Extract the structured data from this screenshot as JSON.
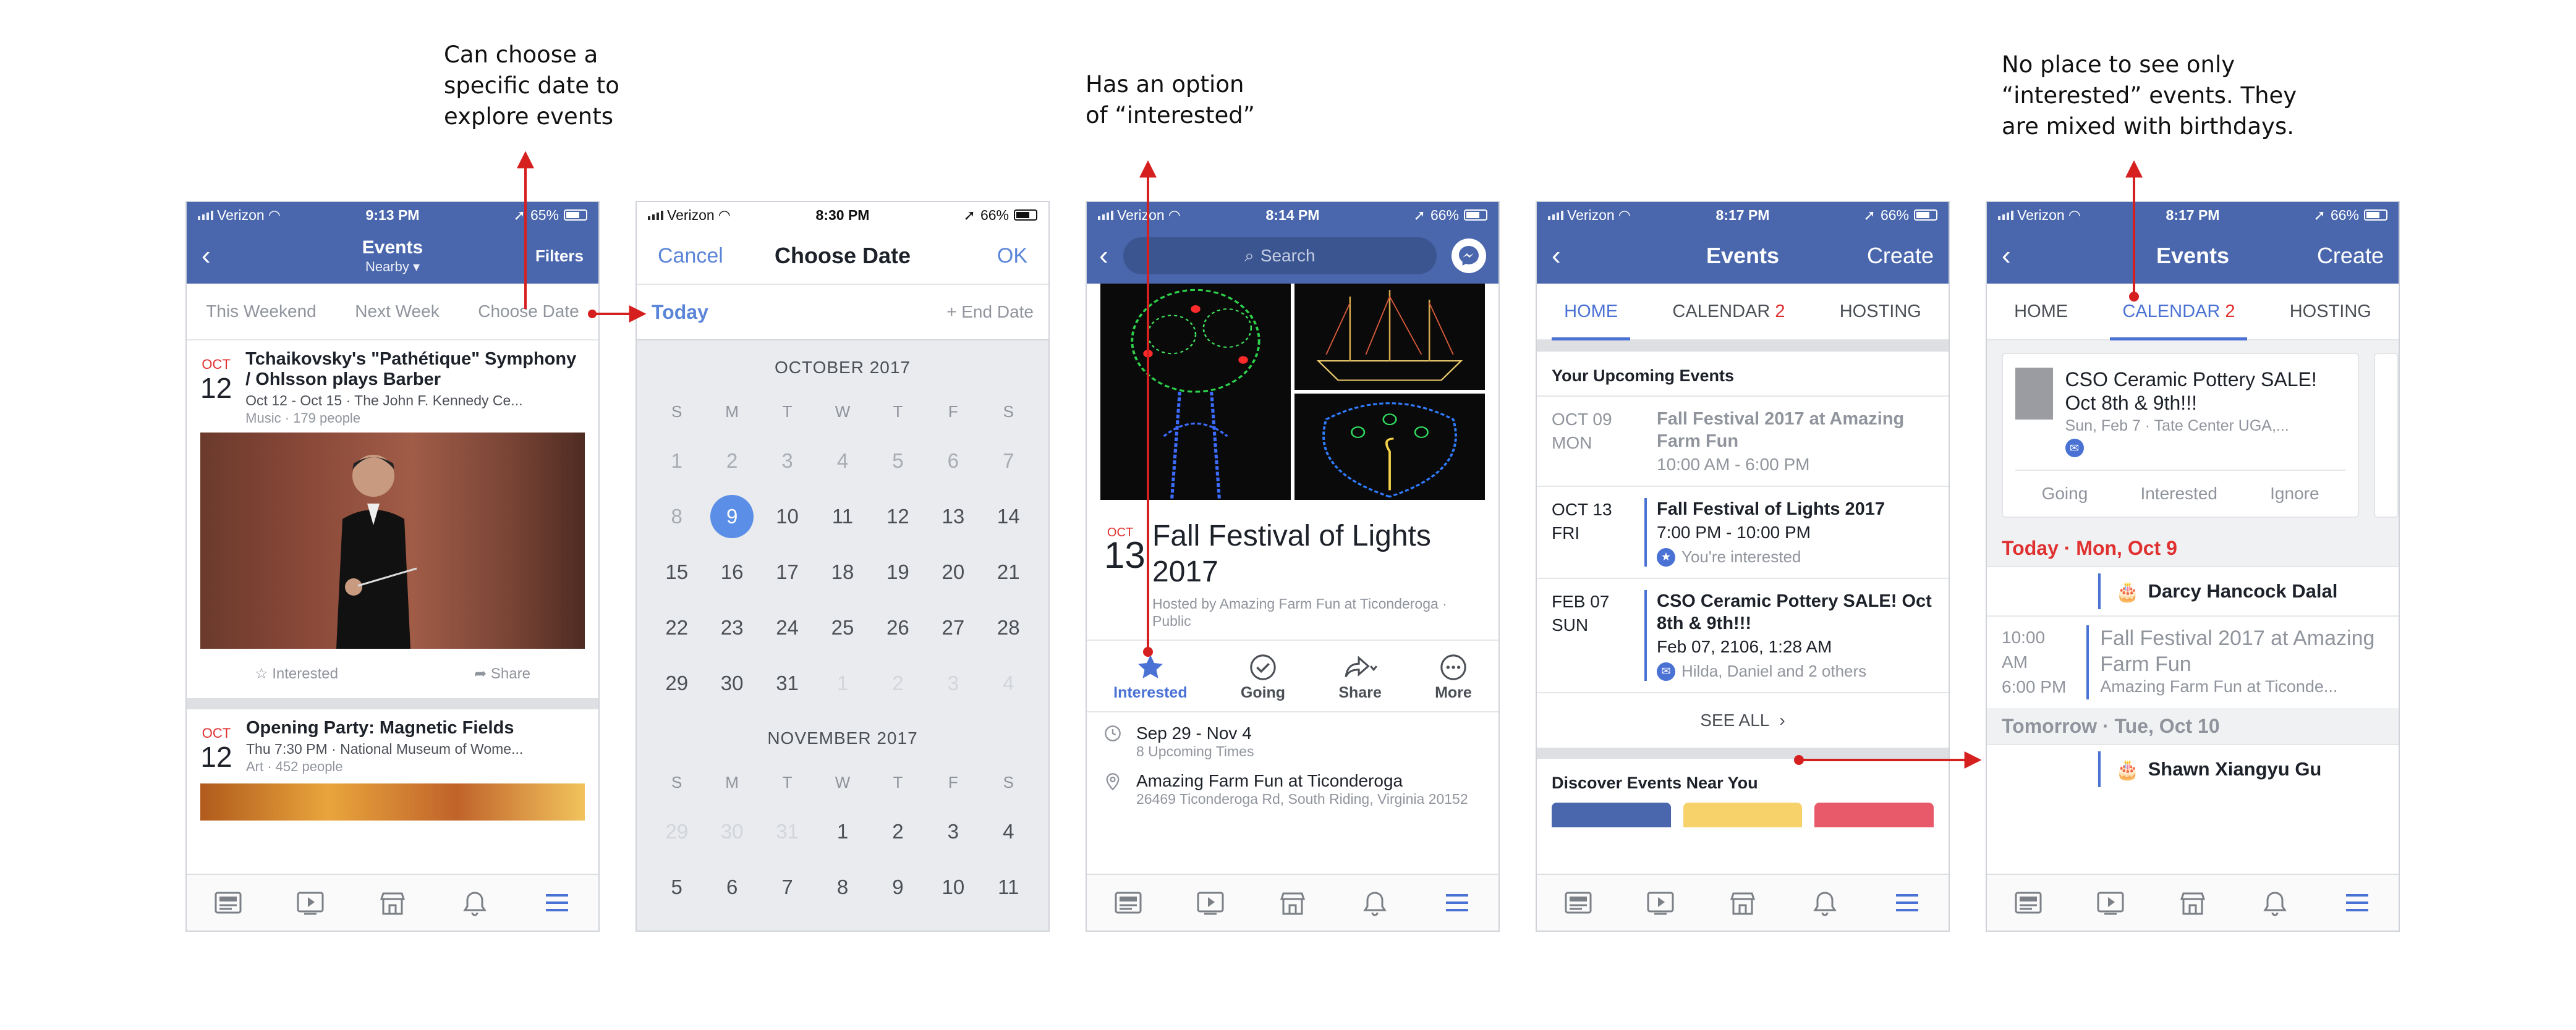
{
  "annotations": {
    "a1": [
      "Can choose a",
      "specific date to",
      "explore events"
    ],
    "a2": [
      "Has an option",
      "of “interested”"
    ],
    "a3": [
      "No place to see only",
      "“interested” events. They",
      "are mixed with birthdays."
    ]
  },
  "colors": {
    "fb_blue": "#4a67ad",
    "link_blue": "#5b85d8",
    "accent_red": "#e03131",
    "annotation_arrow": "#d61f1f"
  },
  "tabbar_icons": [
    "news-feed-icon",
    "video-icon",
    "marketplace-icon",
    "notifications-icon",
    "menu-icon"
  ],
  "phone1": {
    "status": {
      "carrier": "Verizon",
      "time": "9:13 PM",
      "battery": "65%"
    },
    "nav": {
      "title": "Events",
      "subtitle": "Nearby ▾",
      "right": "Filters"
    },
    "filters": [
      "This Weekend",
      "Next Week",
      "Choose Date"
    ],
    "event1": {
      "month": "OCT",
      "day": "12",
      "title": "Tchaikovsky's \"Pathétique\" Symphony / Ohlsson plays Barber",
      "sub": "Oct 12 - Oct 15 · The John F. Kennedy Ce...",
      "meta": "Music · 179 people"
    },
    "actions": {
      "interested": "Interested",
      "share": "Share"
    },
    "event2": {
      "month": "OCT",
      "day": "12",
      "title": "Opening Party: Magnetic Fields",
      "sub": "Thu 7:30 PM · National Museum of Wome...",
      "meta": "Art · 452 people"
    }
  },
  "phone2": {
    "status": {
      "carrier": "Verizon",
      "time": "8:30 PM",
      "battery": "66%"
    },
    "header": {
      "cancel": "Cancel",
      "title": "Choose Date",
      "ok": "OK"
    },
    "range": {
      "start": "Today",
      "end": "+ End Date"
    },
    "weekdays": [
      "S",
      "M",
      "T",
      "W",
      "T",
      "F",
      "S"
    ],
    "october": {
      "label": "OCTOBER 2017",
      "selected": "9",
      "rows": [
        [
          "1",
          "2",
          "3",
          "4",
          "5",
          "6",
          "7"
        ],
        [
          "8",
          "9",
          "10",
          "11",
          "12",
          "13",
          "14"
        ],
        [
          "15",
          "16",
          "17",
          "18",
          "19",
          "20",
          "21"
        ],
        [
          "22",
          "23",
          "24",
          "25",
          "26",
          "27",
          "28"
        ],
        [
          "29",
          "30",
          "31",
          "1",
          "2",
          "3",
          "4"
        ]
      ]
    },
    "november": {
      "label": "NOVEMBER 2017",
      "rows": [
        [
          "29",
          "30",
          "31",
          "1",
          "2",
          "3",
          "4"
        ],
        [
          "5",
          "6",
          "7",
          "8",
          "9",
          "10",
          "11"
        ]
      ]
    }
  },
  "phone3": {
    "status": {
      "carrier": "Verizon",
      "time": "8:14 PM",
      "battery": "66%"
    },
    "search_placeholder": "Search",
    "event": {
      "month": "OCT",
      "day": "13",
      "title": "Fall Festival of Lights 2017",
      "host": "Hosted by Amazing Farm Fun at Ticonderoga · Public"
    },
    "actions": [
      "Interested",
      "Going",
      "Share",
      "More"
    ],
    "details": {
      "dates": "Sep 29 - Nov 4",
      "times": "8 Upcoming Times",
      "place": "Amazing Farm Fun at Ticonderoga",
      "address": "26469 Ticonderoga Rd, South Riding, Virginia 20152"
    }
  },
  "phone4": {
    "status": {
      "carrier": "Verizon",
      "time": "8:17 PM",
      "battery": "66%"
    },
    "nav": {
      "title": "Events",
      "right": "Create"
    },
    "tabs": {
      "home": "HOME",
      "calendar": "CALENDAR",
      "calendar_count": "2",
      "hosting": "HOSTING"
    },
    "upcoming_label": "Your Upcoming Events",
    "rows": [
      {
        "date": "OCT 09",
        "dow": "MON",
        "title": "Fall Festival 2017 at Amazing Farm Fun",
        "sub": "10:00 AM - 6:00 PM"
      },
      {
        "date": "OCT 13",
        "dow": "FRI",
        "title": "Fall Festival of Lights 2017",
        "sub": "7:00 PM - 10:00 PM",
        "note": "You're interested"
      },
      {
        "date": "FEB 07",
        "dow": "SUN",
        "title": "CSO Ceramic Pottery SALE! Oct 8th & 9th!!!",
        "sub": "Feb 07, 2106, 1:28 AM",
        "note": "Hilda, Daniel and 2 others"
      }
    ],
    "see_all": "SEE ALL",
    "discover_label": "Discover Events Near You"
  },
  "phone5": {
    "status": {
      "carrier": "Verizon",
      "time": "8:17 PM",
      "battery": "66%"
    },
    "nav": {
      "title": "Events",
      "right": "Create"
    },
    "tabs": {
      "home": "HOME",
      "calendar": "CALENDAR",
      "calendar_count": "2",
      "hosting": "HOSTING"
    },
    "card": {
      "title": "CSO Ceramic Pottery SALE! Oct 8th & 9th!!!",
      "sub": "Sun, Feb 7 · Tate Center UGA,...",
      "actions": [
        "Going",
        "Interested",
        "Ignore"
      ]
    },
    "today_label": "Today · Mon, Oct 9",
    "birthday1": "Darcy Hancock Dalal",
    "cal_event": {
      "start": "10:00 AM",
      "end": "6:00 PM",
      "title": "Fall Festival 2017 at Amazing Farm Fun",
      "sub": "Amazing Farm Fun at Ticonde..."
    },
    "tomorrow_label": "Tomorrow · Tue, Oct 10",
    "birthday2": "Shawn Xiangyu Gu"
  }
}
